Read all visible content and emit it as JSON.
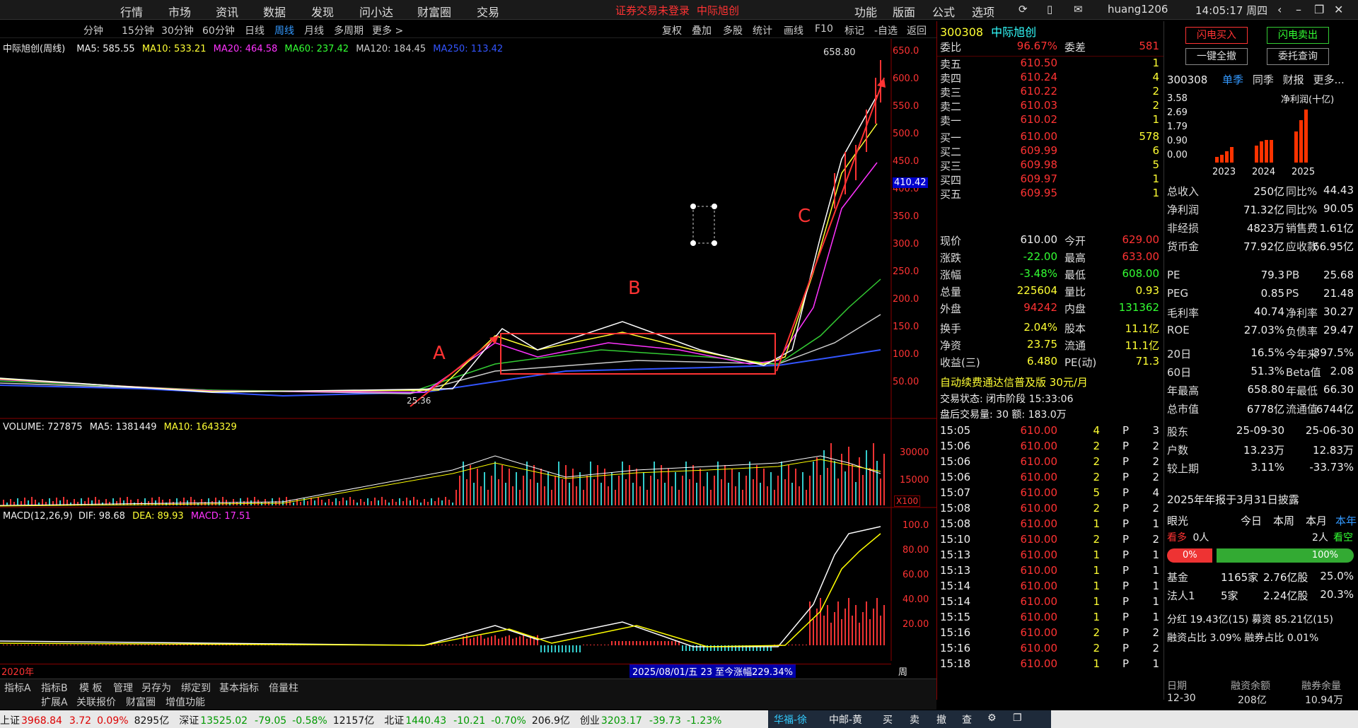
{
  "menu": [
    "行情",
    "市场",
    "资讯",
    "数据",
    "发现",
    "问小达",
    "财富圈",
    "交易"
  ],
  "login_warning": "证券交易未登录",
  "login_stock": "中际旭创",
  "top_right": [
    "功能",
    "版面",
    "公式",
    "选项"
  ],
  "user": "huang1206",
  "clock": "14:05:17 周四",
  "periods": [
    "分钟",
    "15分钟",
    "30分钟",
    "60分钟",
    "日线",
    "周线",
    "月线",
    "多周期",
    "更多 >"
  ],
  "active_period": "周线",
  "tools": [
    "复权",
    "叠加",
    "多股",
    "统计",
    "画线",
    "F10",
    "标记",
    "-自选",
    "返回"
  ],
  "ma_legend": {
    "title": "中际旭创(周线)",
    "ma5": "MA5: 585.55",
    "ma10": "MA10: 533.21",
    "ma20": "MA20: 464.58",
    "ma60": "MA60: 237.42",
    "ma120": "MA120: 184.45",
    "ma250": "MA250: 113.42"
  },
  "price_axis": [
    "650.0",
    "600.0",
    "550.0",
    "500.0",
    "450.0",
    "400.0",
    "350.0",
    "300.0",
    "250.0",
    "200.0",
    "150.0",
    "100.0",
    "50.00"
  ],
  "high_label": "658.80",
  "low_label": "25.36",
  "current_tag": "410.42",
  "annotations": {
    "a": "A",
    "b": "B",
    "c": "C"
  },
  "volume_legend": {
    "vol": "VOLUME: 727875",
    "ma5": "MA5: 1381449",
    "ma10": "MA10: 1643329"
  },
  "volume_axis": [
    "30000",
    "15000"
  ],
  "volume_unit": "X100",
  "macd_legend": {
    "name": "MACD(12,26,9)",
    "dif": "DIF: 98.68",
    "dea": "DEA: 89.93",
    "macd": "MACD: 17.51"
  },
  "macd_axis": [
    "100.0",
    "80.00",
    "60.00",
    "40.00",
    "20.00"
  ],
  "time_axis": [
    "2020年",
    "7",
    "9",
    "11",
    "1",
    "3",
    "5",
    "7",
    "9",
    "11",
    "2",
    "4",
    "6",
    "8",
    "10",
    "1",
    "4",
    "6",
    "8",
    "10",
    "1",
    "4",
    "8",
    "10",
    "12"
  ],
  "time_axis_label": "周线",
  "range_info": "2025/08/01/五 23 至今涨幅229.34%",
  "bottom_tabs": [
    "指标A",
    "指标B",
    "模 板",
    "管理",
    "另存为",
    "绑定到",
    "基本指标",
    "倍量柱"
  ],
  "bottom_tabs2": [
    "扩展A",
    "关联报价",
    "财富圈",
    "增值功能"
  ],
  "stock": {
    "code": "300308",
    "name": "中际旭创"
  },
  "weibi": {
    "l1": "委比",
    "v1": "96.67%",
    "l2": "委差",
    "v2": "581"
  },
  "sells": [
    {
      "label": "卖五",
      "price": "610.50",
      "vol": "1"
    },
    {
      "label": "卖四",
      "price": "610.24",
      "vol": "4"
    },
    {
      "label": "卖三",
      "price": "610.22",
      "vol": "2"
    },
    {
      "label": "卖二",
      "price": "610.03",
      "vol": "2"
    },
    {
      "label": "卖一",
      "price": "610.02",
      "vol": "1"
    }
  ],
  "buys": [
    {
      "label": "买一",
      "price": "610.00",
      "vol": "578"
    },
    {
      "label": "买二",
      "price": "609.99",
      "vol": "6"
    },
    {
      "label": "买三",
      "price": "609.98",
      "vol": "5"
    },
    {
      "label": "买四",
      "price": "609.97",
      "vol": "1"
    },
    {
      "label": "买五",
      "price": "609.95",
      "vol": "1"
    }
  ],
  "quote": [
    {
      "l1": "现价",
      "v1": "610.00",
      "l2": "今开",
      "v2": "629.00",
      "c1": "wht",
      "c2": "red"
    },
    {
      "l1": "涨跌",
      "v1": "-22.00",
      "l2": "最高",
      "v2": "633.00",
      "c1": "grn",
      "c2": "red"
    },
    {
      "l1": "涨幅",
      "v1": "-3.48%",
      "l2": "最低",
      "v2": "608.00",
      "c1": "grn",
      "c2": "grn"
    },
    {
      "l1": "总量",
      "v1": "225604",
      "l2": "量比",
      "v2": "0.93",
      "c1": "yel",
      "c2": "yel"
    },
    {
      "l1": "外盘",
      "v1": "94242",
      "l2": "内盘",
      "v2": "131362",
      "c1": "red",
      "c2": "grn"
    }
  ],
  "stats": [
    {
      "l1": "换手",
      "v1": "2.04%",
      "l2": "股本",
      "v2": "11.1亿"
    },
    {
      "l1": "净资",
      "v1": "23.75",
      "l2": "流通",
      "v2": "11.1亿"
    },
    {
      "l1": "收益(三)",
      "v1": "6.480",
      "l2": "PE(动)",
      "v2": "71.3"
    }
  ],
  "promo": "自动续费通达信普及版 30元/月",
  "trade_status": "交易状态: 闭市阶段 15:33:06",
  "after_hours": "盘后交易量: 30 额: 183.0万",
  "ticks": [
    {
      "t": "15:05",
      "p": "610.00",
      "v": "4",
      "f": "P",
      "n": "3"
    },
    {
      "t": "15:06",
      "p": "610.00",
      "v": "2",
      "f": "P",
      "n": "2"
    },
    {
      "t": "15:06",
      "p": "610.00",
      "v": "2",
      "f": "P",
      "n": "2"
    },
    {
      "t": "15:06",
      "p": "610.00",
      "v": "2",
      "f": "P",
      "n": "2"
    },
    {
      "t": "15:07",
      "p": "610.00",
      "v": "5",
      "f": "P",
      "n": "4"
    },
    {
      "t": "15:08",
      "p": "610.00",
      "v": "2",
      "f": "P",
      "n": "2"
    },
    {
      "t": "15:08",
      "p": "610.00",
      "v": "1",
      "f": "P",
      "n": "1"
    },
    {
      "t": "15:10",
      "p": "610.00",
      "v": "2",
      "f": "P",
      "n": "2"
    },
    {
      "t": "15:13",
      "p": "610.00",
      "v": "1",
      "f": "P",
      "n": "1"
    },
    {
      "t": "15:13",
      "p": "610.00",
      "v": "1",
      "f": "P",
      "n": "1"
    },
    {
      "t": "15:14",
      "p": "610.00",
      "v": "1",
      "f": "P",
      "n": "1"
    },
    {
      "t": "15:14",
      "p": "610.00",
      "v": "1",
      "f": "P",
      "n": "1"
    },
    {
      "t": "15:15",
      "p": "610.00",
      "v": "1",
      "f": "P",
      "n": "1"
    },
    {
      "t": "15:16",
      "p": "610.00",
      "v": "2",
      "f": "P",
      "n": "2"
    },
    {
      "t": "15:16",
      "p": "610.00",
      "v": "2",
      "f": "P",
      "n": "2"
    },
    {
      "t": "15:18",
      "p": "610.00",
      "v": "1",
      "f": "P",
      "n": "1"
    }
  ],
  "bottom_mini_tabs": [
    "笔",
    "价",
    "细",
    "势",
    "联",
    "值",
    "主",
    "逆",
    "筹"
  ],
  "buttons": {
    "flash_buy": "闪电买入",
    "flash_sell": "闪电卖出",
    "clear_all": "一键全撤",
    "order_query": "委托查询"
  },
  "fin_tabs": {
    "code": "300308",
    "t1": "单季",
    "t2": "同季",
    "t3": "财报",
    "t4": "更多..."
  },
  "fin_chart": {
    "title": "净利润(十亿)",
    "yaxis": [
      "3.58",
      "2.69",
      "1.79",
      "0.90",
      "0.00"
    ],
    "years": [
      "2023",
      "2024",
      "2025"
    ]
  },
  "fin_rows": [
    {
      "l1": "总收入",
      "v1": "250亿",
      "l2": "同比%",
      "v2": "44.43"
    },
    {
      "l1": "净利润",
      "v1": "71.32亿",
      "l2": "同比%",
      "v2": "90.05"
    },
    {
      "l1": "非经损",
      "v1": "4823万",
      "l2": "销售费",
      "v2": "1.61亿"
    },
    {
      "l1": "货币金",
      "v1": "77.92亿",
      "l2": "应收款",
      "v2": "66.95亿"
    }
  ],
  "val_rows": [
    {
      "l1": "PE",
      "v1": "79.3",
      "l2": "PB",
      "v2": "25.68"
    },
    {
      "l1": "PEG",
      "v1": "0.85",
      "l2": "PS",
      "v2": "21.48"
    },
    {
      "l1": "毛利率",
      "v1": "40.74",
      "l2": "净利率",
      "v2": "30.27"
    },
    {
      "l1": "ROE",
      "v1": "27.03%",
      "l2": "负债率",
      "v2": "29.47"
    }
  ],
  "perf_rows": [
    {
      "l1": "20日",
      "v1": "16.5%",
      "l2": "今年来",
      "v2": "397.5%"
    },
    {
      "l1": "60日",
      "v1": "51.3%",
      "l2": "Beta值",
      "v2": "2.08"
    },
    {
      "l1": "年最高",
      "v1": "658.80",
      "l2": "年最低",
      "v2": "66.30"
    },
    {
      "l1": "总市值",
      "v1": "6778亿",
      "l2": "流通值",
      "v2": "6744亿"
    }
  ],
  "holder_rows": [
    {
      "l1": "股东",
      "v1": "25-09-30",
      "v2": "25-06-30"
    },
    {
      "l1": "户数",
      "v1": "13.23万",
      "v2": "12.83万"
    },
    {
      "l1": "较上期",
      "v1": "3.11%",
      "v2": "-33.73%"
    }
  ],
  "report_note": "2025年年报于3月31日披露",
  "vision": {
    "title": "眼光",
    "t1": "今日",
    "t2": "本周",
    "t3": "本月",
    "t4": "本年",
    "bull": "看多",
    "bull_n": "0人",
    "bear_n": "2人",
    "bear": "看空",
    "bull_pct": "0%",
    "bear_pct": "100%"
  },
  "inst_rows": [
    {
      "l1": "基金",
      "v1": "1165家",
      "v2": "2.76亿股",
      "v3": "25.0%"
    },
    {
      "l1": "法人1",
      "v1": "5家",
      "v2": "2.24亿股",
      "v3": "20.3%"
    }
  ],
  "margin_rows": [
    {
      "text": "分红 19.43亿(15) 募资 85.21亿(15)"
    },
    {
      "text": "融资占比 3.09% 融券占比 0.01%"
    }
  ],
  "margin_table": {
    "h1": "日期",
    "h2": "融资余额",
    "h3": "融券余量",
    "d1": "12-30",
    "d2": "208亿",
    "d3": "10.94万"
  },
  "status_bar": [
    {
      "label": "上证",
      "val": "3968.84",
      "chg": "3.72",
      "pct": "0.09%",
      "amt": "8295亿"
    },
    {
      "label": "深证",
      "val": "13525.02",
      "chg": "-79.05",
      "pct": "-0.58%",
      "amt": "12157亿"
    },
    {
      "label": "北证",
      "val": "1440.43",
      "chg": "-10.21",
      "pct": "-0.70%",
      "amt": "206.9亿"
    },
    {
      "label": "创业",
      "val": "3203.17",
      "chg": "-39.73",
      "pct": "-1.23%",
      "amt": ""
    }
  ],
  "status_tabs": [
    "华福-徐",
    "中邮-黄",
    "买",
    "卖",
    "撤",
    "查"
  ]
}
